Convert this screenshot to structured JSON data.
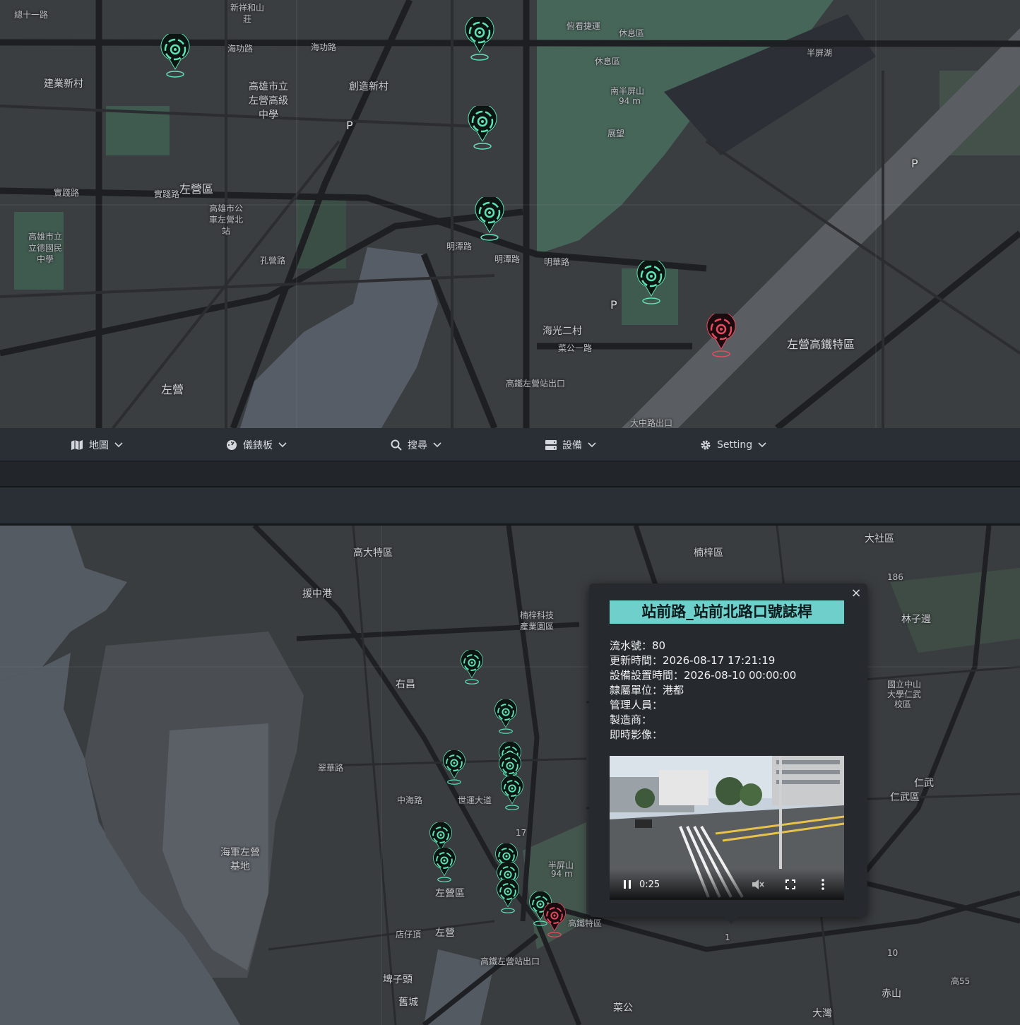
{
  "top_map": {
    "labels": [
      "總十一路",
      "新祥和山",
      "莊",
      "海功路",
      "海功路",
      "建業新村",
      "高雄市立",
      "左營高級",
      "中學",
      "創造新村",
      "俯看捷運",
      "休息區",
      "休息區",
      "南半屏山",
      "94 m",
      "展望",
      "半屏湖",
      "P",
      "左營區",
      "實踐路",
      "實踐路",
      "高雄市立",
      "立德國民",
      "中學",
      "高雄市公",
      "車左營北",
      "站",
      "明潭路",
      "明潭路",
      "明華路",
      "海光二村",
      "菜公一路",
      "孔營路",
      "P",
      "左營",
      "左營高鐵特區",
      "高鐵左營站出口",
      "大中路出口",
      "P"
    ]
  },
  "nav": {
    "map": "地圖",
    "dashboard": "儀錶板",
    "search": "搜尋",
    "device": "設備",
    "setting": "Setting"
  },
  "bottom_map": {
    "labels": [
      "高大特區",
      "援中港",
      "右昌",
      "楠梓科技",
      "產業園區",
      "楠梓區",
      "大社區",
      "林子邊",
      "國立中山",
      "大學仁武",
      "校區",
      "仁武區",
      "仁武",
      "海軍左營",
      "基地",
      "左營區",
      "左營",
      "高鐵特區",
      "高鐵左營站出口",
      "店仔頂",
      "埤子頭",
      "舊城",
      "菜公",
      "大灣",
      "赤山",
      "半屏山",
      "94 m",
      "中海路",
      "世運大道",
      "翠華路",
      "186",
      "17",
      "10",
      "1",
      "高55"
    ]
  },
  "popup": {
    "close": "×",
    "title": "站前路_站前北路口號誌桿",
    "rows": [
      "流水號：80",
      "更新時間：2026-08-17 17:21:19",
      "設備設置時間：2026-08-10 00:00:00",
      "隸屬單位：港都",
      "管理人員：",
      "製造商：",
      "即時影像："
    ],
    "video_time": "0:25"
  },
  "colors": {
    "marker_green": "#5ee3b5",
    "marker_red": "#e84a5f",
    "accent": "#6fcfcb"
  }
}
